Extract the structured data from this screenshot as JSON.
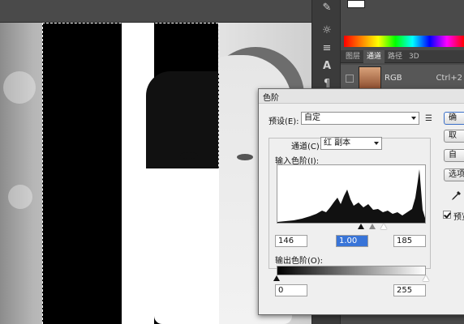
{
  "right_panel": {
    "tabs": [
      "图层",
      "通道",
      "路径",
      "3D"
    ],
    "active_tab": "通道",
    "channel": {
      "name": "RGB",
      "shortcut": "Ctrl+2"
    }
  },
  "levels_dialog": {
    "title": "色阶",
    "preset_label": "预设(E):",
    "preset_value": "自定",
    "channel_label": "通道(C):",
    "channel_value": "红 副本",
    "input_levels_label": "输入色阶(I):",
    "input_black": "146",
    "input_gamma": "1.00",
    "input_white": "185",
    "output_levels_label": "输出色阶(O):",
    "output_black": "0",
    "output_white": "255",
    "buttons": {
      "ok": "确",
      "reset": "取",
      "auto": "自",
      "options": "选项"
    },
    "preview_label": "预览"
  }
}
